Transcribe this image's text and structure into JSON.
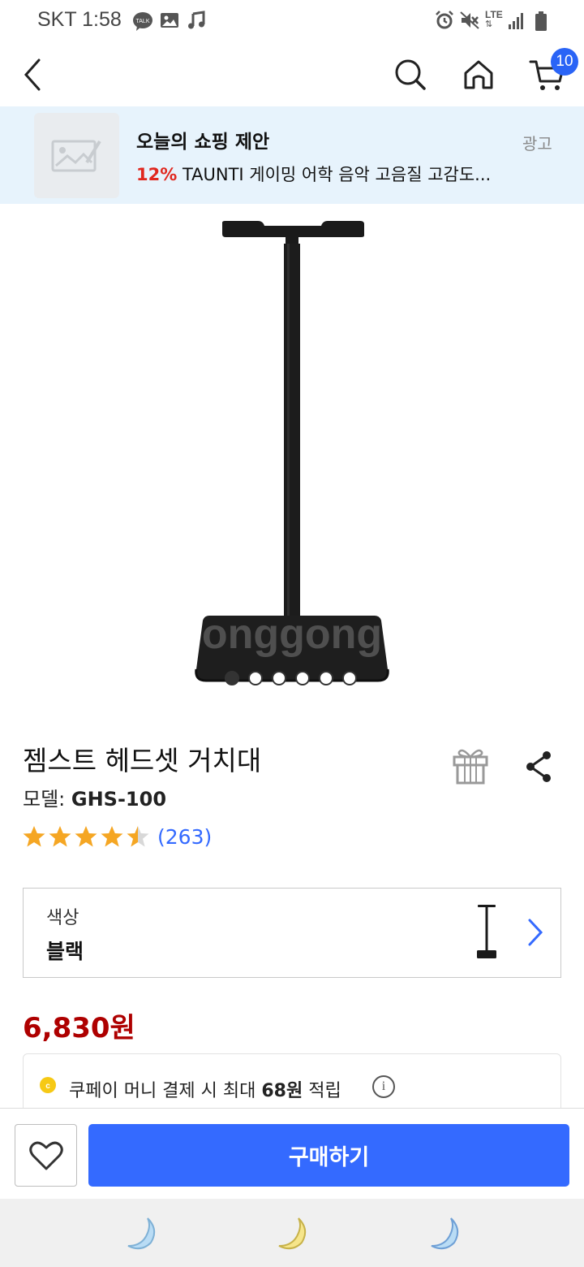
{
  "status_bar": {
    "carrier_time": "SKT 1:58",
    "network": "LTE",
    "icons": [
      "talk-icon",
      "gallery-icon",
      "music-icon",
      "alarm-icon",
      "mute-icon",
      "lte-icon",
      "signal-icon",
      "battery-icon"
    ]
  },
  "nav": {
    "back_icon": "back-icon",
    "search_icon": "search-icon",
    "home_icon": "home-icon",
    "cart_icon": "cart-icon",
    "cart_count": "10"
  },
  "ad": {
    "title": "오늘의 쇼핑 제안",
    "discount": "12%",
    "text": "TAUNTI 게이밍 어학 음악 고음질 고감도...",
    "badge": "광고"
  },
  "product": {
    "image_watermark": "onggong",
    "carousel_count": 6,
    "carousel_active": 1,
    "title": "젬스트 헤드셋 거치대",
    "model_label": "모델:",
    "model_value": "GHS-100",
    "rating": 4.5,
    "review_count": "(263)",
    "price": "6,830원"
  },
  "option": {
    "label": "색상",
    "value": "블랙"
  },
  "coupay": {
    "prefix": "쿠페이 머니 결제 시 최대 ",
    "amount": "68원",
    "suffix": " 적립"
  },
  "actions": {
    "buy_label": "구매하기"
  },
  "colors": {
    "accent": "#346aff",
    "price": "#ae0000",
    "star": "#f5a623",
    "ad_bg": "#e7f3fc"
  }
}
